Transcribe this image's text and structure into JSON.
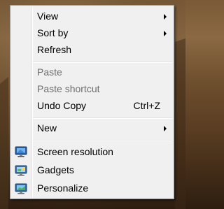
{
  "context_menu": {
    "groups": [
      [
        {
          "label": "View",
          "has_submenu": true,
          "enabled": true
        },
        {
          "label": "Sort by",
          "has_submenu": true,
          "enabled": true
        },
        {
          "label": "Refresh",
          "has_submenu": false,
          "enabled": true
        }
      ],
      [
        {
          "label": "Paste",
          "has_submenu": false,
          "enabled": false
        },
        {
          "label": "Paste shortcut",
          "has_submenu": false,
          "enabled": false
        },
        {
          "label": "Undo Copy",
          "shortcut": "Ctrl+Z",
          "has_submenu": false,
          "enabled": true
        }
      ],
      [
        {
          "label": "New",
          "has_submenu": true,
          "enabled": true
        }
      ],
      [
        {
          "label": "Screen resolution",
          "icon": "screen-resolution-icon",
          "enabled": true
        },
        {
          "label": "Gadgets",
          "icon": "gadgets-icon",
          "enabled": true
        },
        {
          "label": "Personalize",
          "icon": "personalize-icon",
          "enabled": true
        }
      ]
    ]
  },
  "colors": {
    "menu_background": "#f0f0f0",
    "menu_border": "#979797",
    "disabled_text": "#6d6d6d"
  }
}
